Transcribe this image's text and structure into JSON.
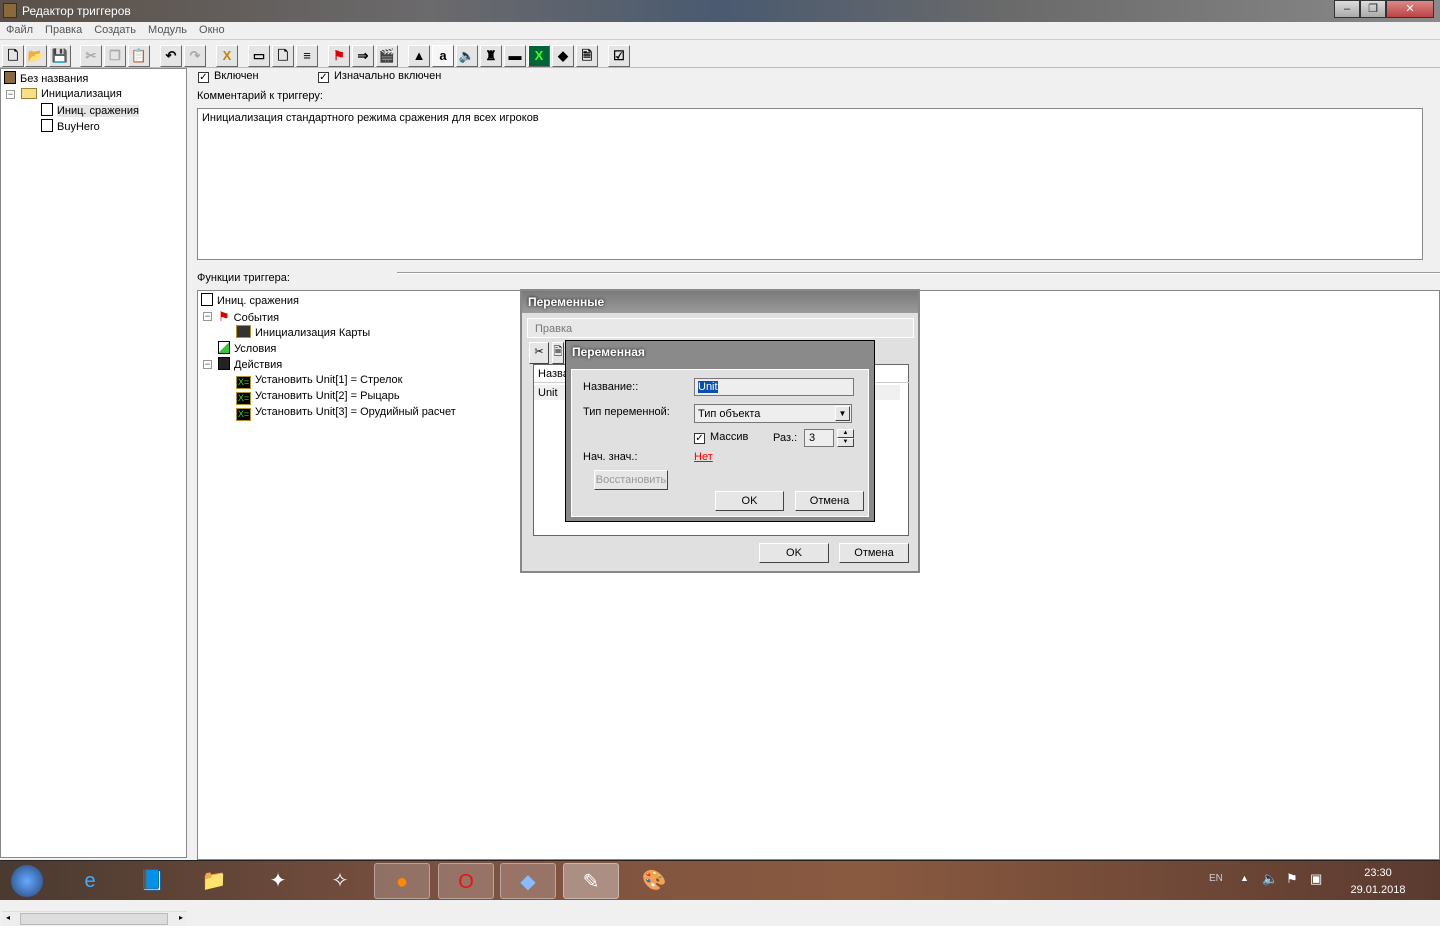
{
  "window": {
    "title": "Редактор триггеров"
  },
  "menu": [
    "Файл",
    "Правка",
    "Создать",
    "Модуль",
    "Окно"
  ],
  "toolbar": [
    {
      "icon": "new-icon",
      "glyph": "🗋"
    },
    {
      "icon": "open-icon",
      "glyph": "📂"
    },
    {
      "icon": "save-icon",
      "glyph": "💾"
    },
    {
      "icon": "cut-icon",
      "glyph": "✂"
    },
    {
      "icon": "copy-icon",
      "glyph": "❐"
    },
    {
      "icon": "paste-icon",
      "glyph": "📋"
    },
    {
      "icon": "undo-icon",
      "glyph": "↶"
    },
    {
      "icon": "redo-icon",
      "glyph": "↷"
    },
    {
      "icon": "delete-icon",
      "glyph": "X"
    },
    {
      "icon": "new-category-icon",
      "glyph": "▭"
    },
    {
      "icon": "new-trigger-icon",
      "glyph": "🗋"
    },
    {
      "icon": "new-comment-icon",
      "glyph": "≡"
    },
    {
      "icon": "new-event-icon",
      "glyph": "⚑"
    },
    {
      "icon": "new-condition-icon",
      "glyph": "⇒"
    },
    {
      "icon": "new-action-icon",
      "glyph": "🎬"
    },
    {
      "icon": "terrain-editor-icon",
      "glyph": "▲"
    },
    {
      "icon": "object-editor-icon",
      "glyph": "a"
    },
    {
      "icon": "sound-editor-icon",
      "glyph": "🔈"
    },
    {
      "icon": "unit-editor-icon",
      "glyph": "♜"
    },
    {
      "icon": "ai-editor-icon",
      "glyph": "▬"
    },
    {
      "icon": "variables-icon",
      "glyph": "X"
    },
    {
      "icon": "import-icon",
      "glyph": "◆"
    },
    {
      "icon": "script-icon",
      "glyph": "🗎"
    },
    {
      "icon": "test-map-icon",
      "glyph": "☑"
    }
  ],
  "tree": {
    "root": "Без названия",
    "category": "Инициализация",
    "triggers": [
      "Иниц. сражения",
      "BuyHero"
    ]
  },
  "trigger": {
    "enabled_label": "Включен",
    "initially_on_label": "Изначально включен",
    "comment_label": "Комментарий к триггеру:",
    "comment": "Инициализация стандартного режима сражения для всех игроков",
    "functions_label": "Функции триггера:"
  },
  "functions": {
    "name": "Иниц. сражения",
    "events_label": "События",
    "event": "Инициализация Карты",
    "conditions_label": "Условия",
    "actions_label": "Действия",
    "actions": [
      "Установить Unit[1] = Стрелок",
      "Установить Unit[2] = Рыцарь",
      "Установить Unit[3] = Орудийный расчет"
    ]
  },
  "variables_dialog": {
    "title": "Переменные",
    "menu": "Правка",
    "col_name": "Назва",
    "row": "Unit",
    "ok": "OK",
    "cancel": "Отмена"
  },
  "variable_dialog": {
    "title": "Переменная",
    "name_label": "Название::",
    "name_value": "Unit",
    "type_label": "Тип переменной:",
    "type_value": "Тип объекта",
    "array_label": "Массив",
    "size_label": "Раз.:",
    "size_value": "3",
    "init_label": "Нач. знач.:",
    "init_value": "Нет",
    "restore": "Восстановить",
    "ok": "OK",
    "cancel": "Отмена",
    "init_color": "#ff0000"
  },
  "taskbar": {
    "lang": "EN",
    "time": "23:30",
    "date": "29.01.2018"
  }
}
